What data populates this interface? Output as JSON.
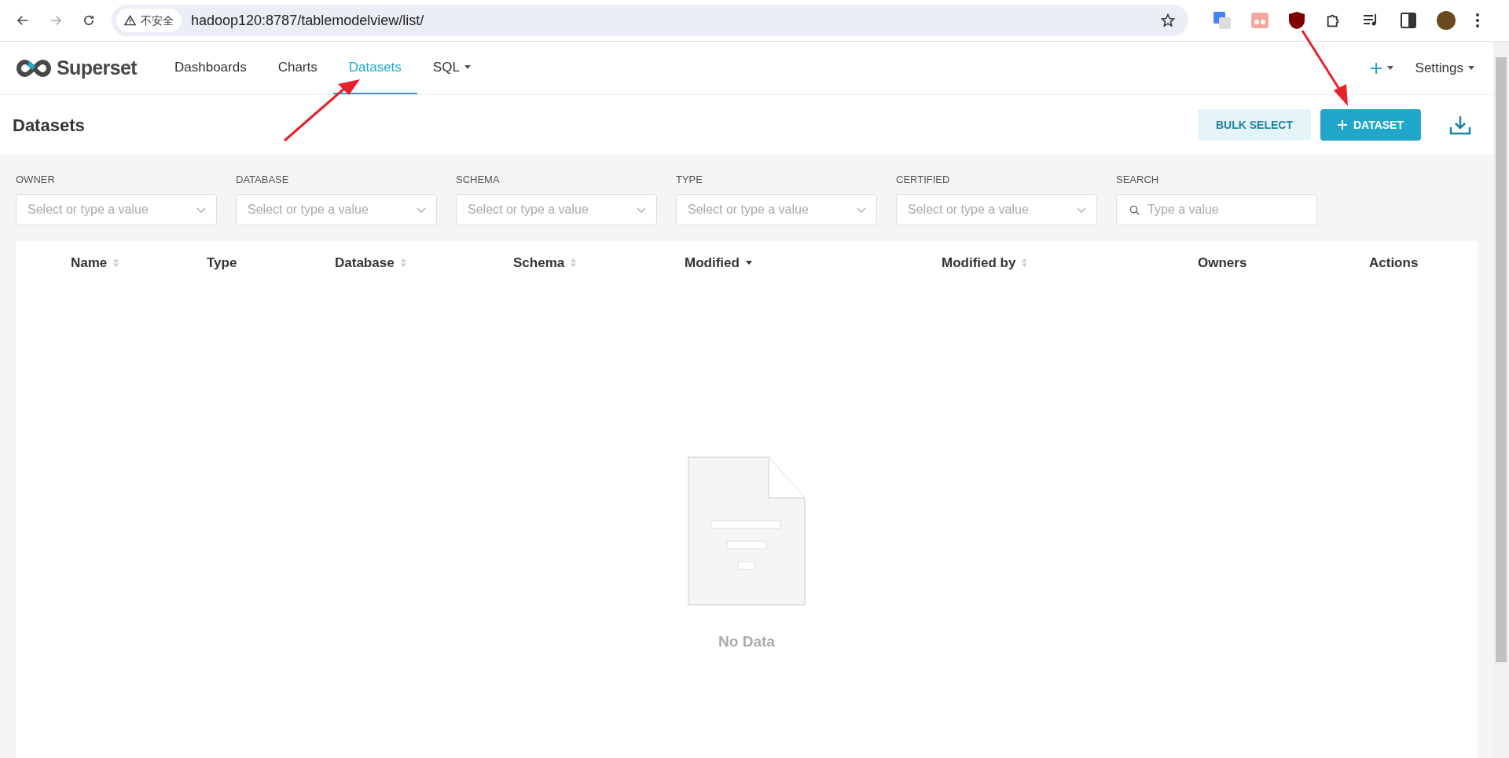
{
  "browser": {
    "security_label": "不安全",
    "url": "hadoop120:8787/tablemodelview/list/"
  },
  "nav": {
    "brand": "Superset",
    "items": [
      {
        "label": "Dashboards",
        "selected": false,
        "dropdown": false
      },
      {
        "label": "Charts",
        "selected": false,
        "dropdown": false
      },
      {
        "label": "Datasets",
        "selected": true,
        "dropdown": false
      },
      {
        "label": "SQL",
        "selected": false,
        "dropdown": true
      }
    ],
    "settings": "Settings"
  },
  "page": {
    "title": "Datasets",
    "bulk_select": "BULK SELECT",
    "add_dataset": "DATASET"
  },
  "filters": [
    {
      "label": "OWNER",
      "kind": "select",
      "placeholder": "Select or type a value"
    },
    {
      "label": "DATABASE",
      "kind": "select",
      "placeholder": "Select or type a value"
    },
    {
      "label": "SCHEMA",
      "kind": "select",
      "placeholder": "Select or type a value"
    },
    {
      "label": "TYPE",
      "kind": "select",
      "placeholder": "Select or type a value"
    },
    {
      "label": "CERTIFIED",
      "kind": "select",
      "placeholder": "Select or type a value"
    },
    {
      "label": "SEARCH",
      "kind": "search",
      "placeholder": "Type a value"
    }
  ],
  "table": {
    "columns": [
      {
        "label": "Name",
        "sortable": true,
        "sorted_desc": false
      },
      {
        "label": "Type",
        "sortable": false
      },
      {
        "label": "Database",
        "sortable": true,
        "sorted_desc": false
      },
      {
        "label": "Schema",
        "sortable": true,
        "sorted_desc": false
      },
      {
        "label": "Modified",
        "sortable": true,
        "sorted_desc": true
      },
      {
        "label": "Modified by",
        "sortable": true,
        "sorted_desc": false
      },
      {
        "label": "Owners",
        "sortable": false
      },
      {
        "label": "Actions",
        "sortable": false
      }
    ],
    "empty": "No Data"
  }
}
